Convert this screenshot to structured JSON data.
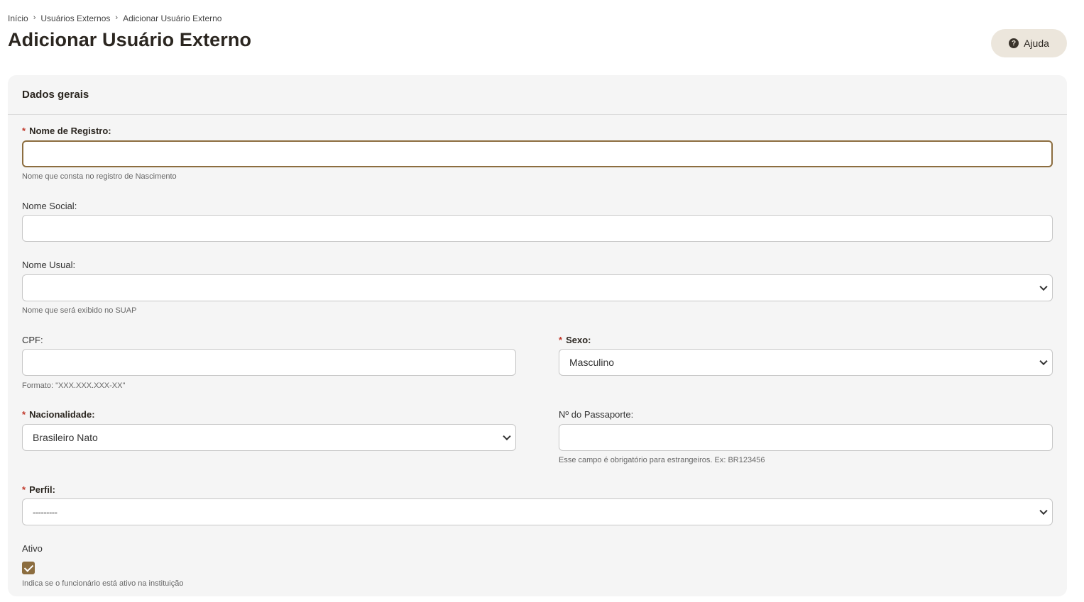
{
  "breadcrumb": {
    "items": [
      "Início",
      "Usuários Externos",
      "Adicionar Usuário Externo"
    ],
    "separator": "›"
  },
  "page": {
    "title": "Adicionar Usuário Externo"
  },
  "help": {
    "label": "Ajuda",
    "icon": "question-circle-icon"
  },
  "section": {
    "title": "Dados gerais"
  },
  "form": {
    "required_mark": "*",
    "nome_registro": {
      "label": "Nome de Registro:",
      "value": "",
      "hint": "Nome que consta no registro de Nascimento"
    },
    "nome_social": {
      "label": "Nome Social:",
      "value": ""
    },
    "nome_usual": {
      "label": "Nome Usual:",
      "value": "",
      "hint": "Nome que será exibido no SUAP"
    },
    "cpf": {
      "label": "CPF:",
      "value": "",
      "hint": "Formato: \"XXX.XXX.XXX-XX\""
    },
    "sexo": {
      "label": "Sexo:",
      "value": "Masculino"
    },
    "nacionalidade": {
      "label": "Nacionalidade:",
      "value": "Brasileiro Nato"
    },
    "passaporte": {
      "label": "Nº do Passaporte:",
      "value": "",
      "hint": "Esse campo é obrigatório para estrangeiros. Ex: BR123456"
    },
    "perfil": {
      "label": "Perfil:",
      "value": "---------"
    },
    "ativo": {
      "label": "Ativo",
      "checked": true,
      "hint": "Indica se o funcionário está ativo na instituição"
    }
  },
  "colors": {
    "accent": "#8c6d3f",
    "required": "#c0392b",
    "card_bg": "#f5f5f5",
    "help_bg": "#ece6dc"
  }
}
